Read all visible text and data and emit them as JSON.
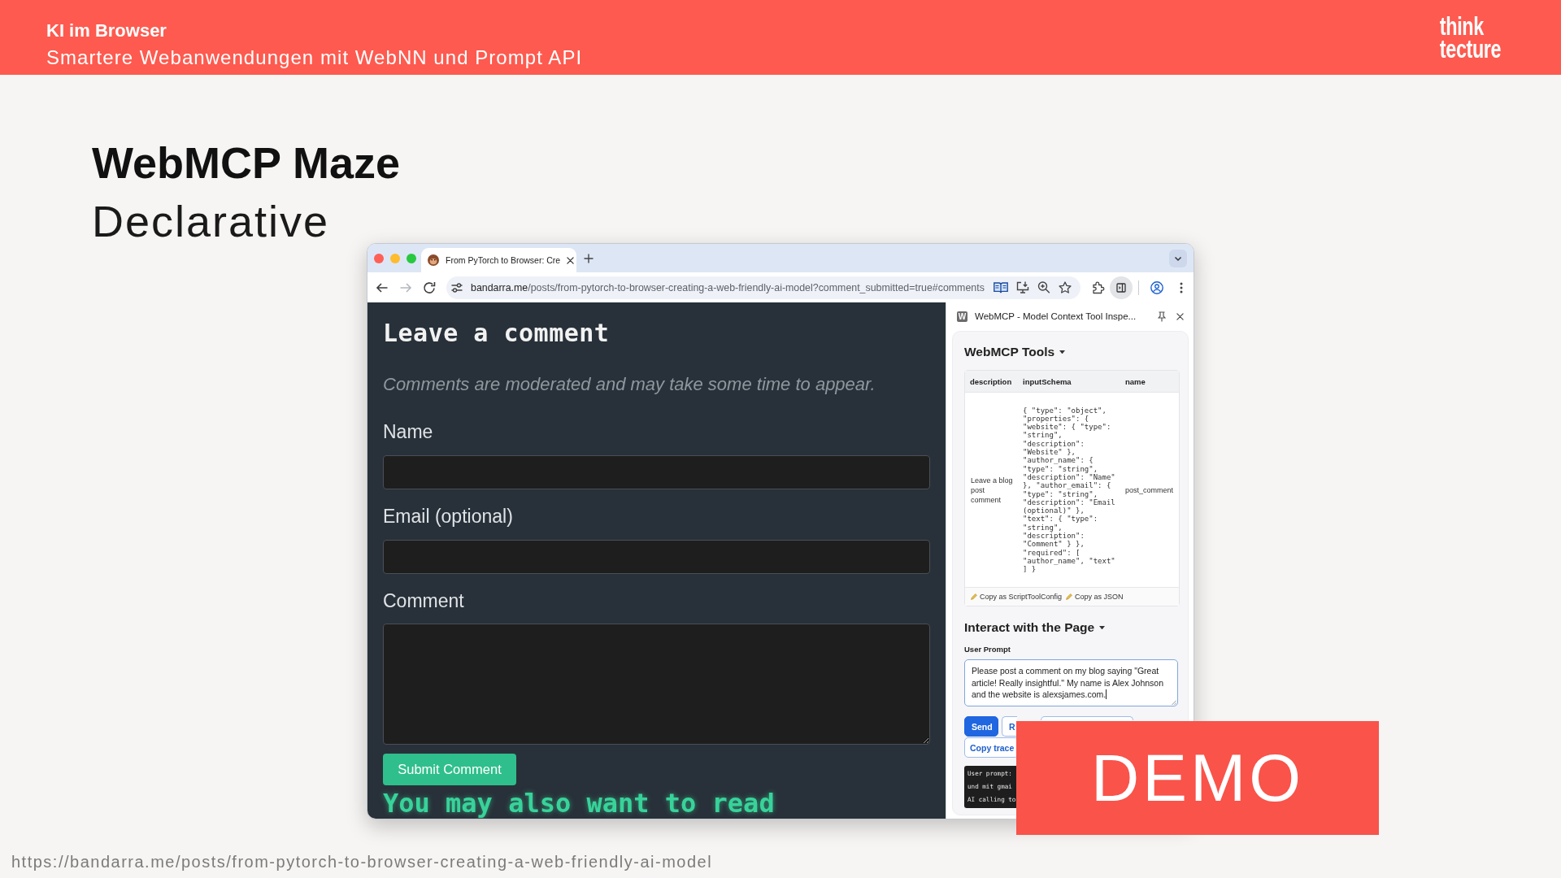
{
  "header": {
    "title": "KI im Browser",
    "subtitle": "Smartere Webanwendungen mit WebNN und Prompt API",
    "logo": [
      "think",
      "tecture"
    ]
  },
  "slide": {
    "title": "WebMCP Maze",
    "subtitle": "Declarative"
  },
  "browser": {
    "tabs": [
      {
        "title": "From PyTorch to Browser: Cre",
        "selected": true
      }
    ],
    "address": {
      "host": "bandarra.me",
      "path": "/posts/from-pytorch-to-browser-creating-a-web-friendly-ai-model?comment_submitted=true#comments"
    },
    "page": {
      "heading": "Leave a comment",
      "note": "Comments are moderated and may take some time to appear.",
      "fields": [
        {
          "label": "Name",
          "kind": "input"
        },
        {
          "label": "Email (optional)",
          "kind": "input"
        },
        {
          "label": "Comment",
          "kind": "textarea"
        }
      ],
      "submit_button": "Submit Comment",
      "next_heading": "You may also want to read"
    },
    "side_panel": {
      "badge": "W",
      "title": "WebMCP - Model Context Tool Inspe...",
      "tools": {
        "heading": "WebMCP Tools",
        "expanded": true,
        "table": {
          "columns": [
            "description",
            "inputSchema",
            "name"
          ],
          "rows": [
            [
              "Leave a blog post comment",
              "{ \"type\": \"object\", \"properties\": { \"website\": { \"type\": \"string\", \"description\": \"Website\" }, \"author_name\": { \"type\": \"string\", \"description\": \"Name\" }, \"author_email\": { \"type\": \"string\", \"description\": \"Email (optional)\" }, \"text\": { \"type\": \"string\", \"description\": \"Comment\" } }, \"required\": [ \"author_name\", \"text\" ] }",
              "post_comment"
            ]
          ]
        },
        "actions": [
          "Copy as ScriptToolConfig",
          "Copy as JSON"
        ]
      },
      "interact": {
        "heading": "Interact with the Page",
        "expanded": true,
        "prompt_label": "User Prompt",
        "prompt": "Please post a comment on my blog saying \"Great article! Really insightful.\" My name is Alex Johnson and the website is alexsjames.com.",
        "button_rows": [
          [
            {
              "label": "Send",
              "kind": "primary"
            },
            {
              "label": "R",
              "kind": "outline"
            },
            {
              "kind": "blank"
            }
          ],
          [
            {
              "label": "Copy trace",
              "kind": "outline"
            }
          ]
        ],
        "log": [
          "User prompt:",
          "und mit gmai",
          "AI calling to"
        ]
      }
    }
  },
  "demo_label": "DEMO",
  "source_url": "https://bandarra.me/posts/from-pytorch-to-browser-creating-a-web-friendly-ai-model"
}
